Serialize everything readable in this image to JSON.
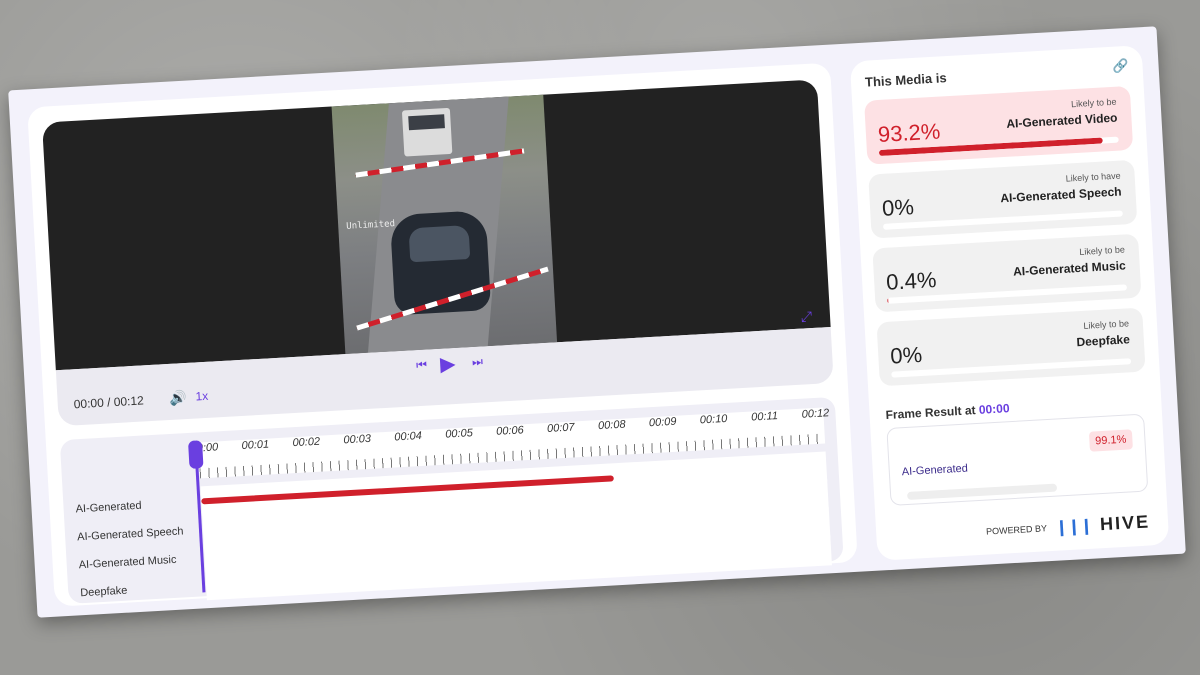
{
  "player": {
    "time_display": "00:00 / 00:12",
    "speed_label": "1x",
    "watermark": "Unlimited"
  },
  "timeline": {
    "ticks": [
      "00:00",
      "00:01",
      "00:02",
      "00:03",
      "00:04",
      "00:05",
      "00:06",
      "00:07",
      "00:08",
      "00:09",
      "00:10",
      "00:11",
      "00:12"
    ],
    "tracks": [
      {
        "label": "AI-Generated",
        "flag_fraction": 0.66
      },
      {
        "label": "AI-Generated Speech",
        "flag_fraction": 0
      },
      {
        "label": "AI-Generated Music",
        "flag_fraction": 0
      },
      {
        "label": "Deepfake",
        "flag_fraction": 0
      }
    ]
  },
  "panel": {
    "title": "This Media is",
    "results": [
      {
        "percent": "93.2%",
        "likely": "Likely to be",
        "label": "AI-Generated Video",
        "fraction": 0.932
      },
      {
        "percent": "0%",
        "likely": "Likely to have",
        "label": "AI-Generated Speech",
        "fraction": 0
      },
      {
        "percent": "0.4%",
        "likely": "Likely to be",
        "label": "AI-Generated Music",
        "fraction": 0.004
      },
      {
        "percent": "0%",
        "likely": "Likely to be",
        "label": "Deepfake",
        "fraction": 0
      }
    ],
    "frame_result_label": "Frame Result at",
    "frame_result_time": "00:00",
    "frame_item_label": "AI-Generated",
    "frame_item_value": "99.1%",
    "powered_by": "POWERED BY",
    "brand": "HIVE"
  },
  "colors": {
    "accent": "#6a3fe0",
    "alert": "#d0202b"
  }
}
